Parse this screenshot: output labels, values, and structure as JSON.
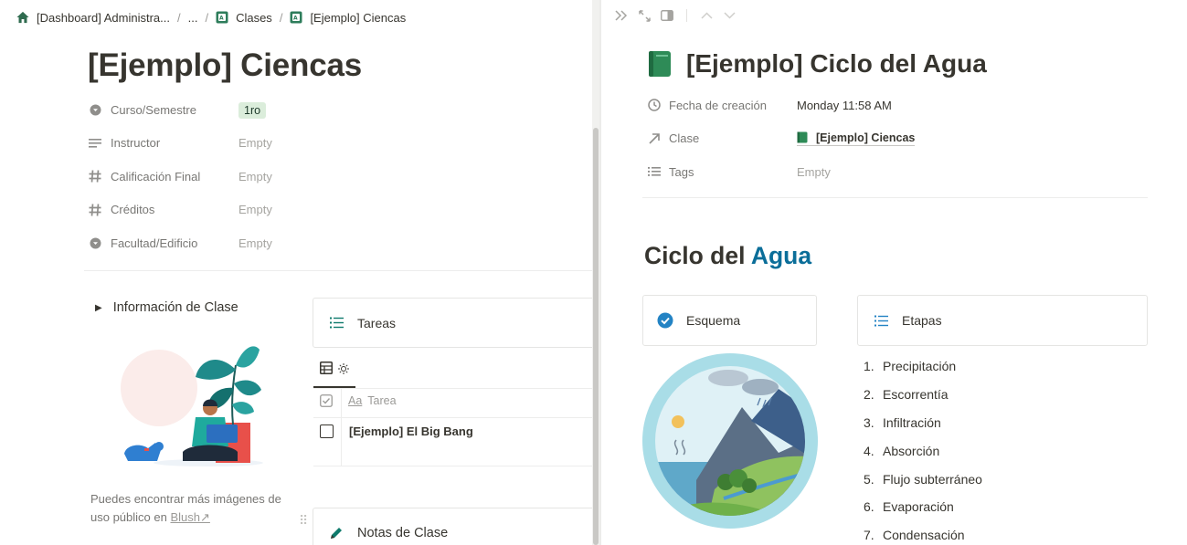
{
  "breadcrumb": {
    "items": [
      {
        "label": "[Dashboard] Administra..."
      },
      {
        "label": "..."
      },
      {
        "label": "Clases"
      },
      {
        "label": "[Ejemplo] Ciencas"
      }
    ],
    "separator": "/"
  },
  "left_page": {
    "title": "[Ejemplo] Ciencas",
    "properties": [
      {
        "name": "Curso/Semestre",
        "icon": "select-icon",
        "value": "1ro",
        "type": "tag"
      },
      {
        "name": "Instructor",
        "icon": "text-icon",
        "value": "Empty",
        "type": "empty"
      },
      {
        "name": "Calificación Final",
        "icon": "number-icon",
        "value": "Empty",
        "type": "empty"
      },
      {
        "name": "Créditos",
        "icon": "number-icon",
        "value": "Empty",
        "type": "empty"
      },
      {
        "name": "Facultad/Edificio",
        "icon": "select-icon",
        "value": "Empty",
        "type": "empty"
      }
    ],
    "toggle_label": "Información de Clase",
    "caption_text": "Puedes encontrar más imágenes de uso público en",
    "caption_link": "Blush",
    "caption_link_arrow": "↗",
    "tareas": {
      "title": "Tareas",
      "column_header": "Tarea",
      "column_icon_label": "Aa",
      "rows": [
        {
          "name": "[Ejemplo] El Big Bang",
          "checked": false
        }
      ]
    },
    "notas": {
      "title": "Notas de Clase"
    }
  },
  "right_page": {
    "title": "[Ejemplo] Ciclo del Agua",
    "properties": {
      "created": {
        "name": "Fecha de creación",
        "value": "Monday 11:58 AM"
      },
      "clase": {
        "name": "Clase",
        "value": "[Ejemplo] Ciencas"
      },
      "tags": {
        "name": "Tags",
        "value": "Empty"
      }
    },
    "heading_prefix": "Ciclo del",
    "heading_accent": "Agua",
    "esquema": {
      "title": "Esquema"
    },
    "etapas": {
      "title": "Etapas",
      "items": [
        {
          "num": "1.",
          "label": "Precipitación"
        },
        {
          "num": "2.",
          "label": "Escorrentía"
        },
        {
          "num": "3.",
          "label": "Infiltración"
        },
        {
          "num": "4.",
          "label": "Absorción"
        },
        {
          "num": "5.",
          "label": "Flujo subterráneo"
        },
        {
          "num": "6.",
          "label": "Evaporación"
        },
        {
          "num": "7.",
          "label": "Condensación"
        }
      ]
    }
  },
  "colors": {
    "text": "#37352f",
    "muted": "#787774",
    "tag_bg": "#dbeddb",
    "accent_blue": "#0b6e99",
    "icon_green": "#2e7d5b",
    "home_green": "#2f6b4f"
  }
}
